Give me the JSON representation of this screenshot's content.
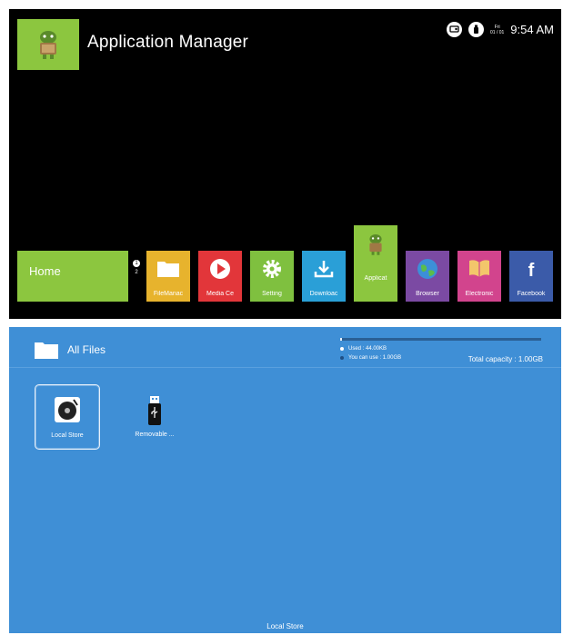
{
  "launcher": {
    "app_title": "Application Manager",
    "status": {
      "day": "Fri",
      "date": "01 / 01",
      "time": "9:54 AM",
      "icons": [
        "network-icon",
        "usb-icon"
      ]
    },
    "home_label": "Home",
    "page_indicator": [
      "1",
      "2"
    ],
    "tiles": [
      {
        "label": "FileManac",
        "color": "#e7b32d",
        "icon": "folder-icon"
      },
      {
        "label": "Media Ce",
        "color": "#e2363a",
        "icon": "play-icon"
      },
      {
        "label": "Setting",
        "color": "#7fc03f",
        "icon": "gear-icon"
      },
      {
        "label": "Downloac",
        "color": "#2a9fd7",
        "icon": "download-icon"
      },
      {
        "label": "Applicat",
        "color": "#8cc63f",
        "icon": "android-icon"
      },
      {
        "label": "Browser",
        "color": "#7b4aa3",
        "icon": "globe-icon"
      },
      {
        "label": "Electronic",
        "color": "#d2448d",
        "icon": "book-icon"
      },
      {
        "label": "Facebook",
        "color": "#3b5ba9",
        "icon": "facebook-icon"
      }
    ]
  },
  "file_manager": {
    "title": "All Files",
    "used": "Used : 44.00KB",
    "can_use": "You can use : 1.00GB",
    "total": "Total capacity : 1.00GB",
    "used_fraction": 0.01,
    "devices": [
      {
        "label": "Local Store",
        "icon": "disk-icon"
      },
      {
        "label": "Removable ...",
        "icon": "usb-drive-icon"
      }
    ],
    "footer": "Local Store"
  }
}
